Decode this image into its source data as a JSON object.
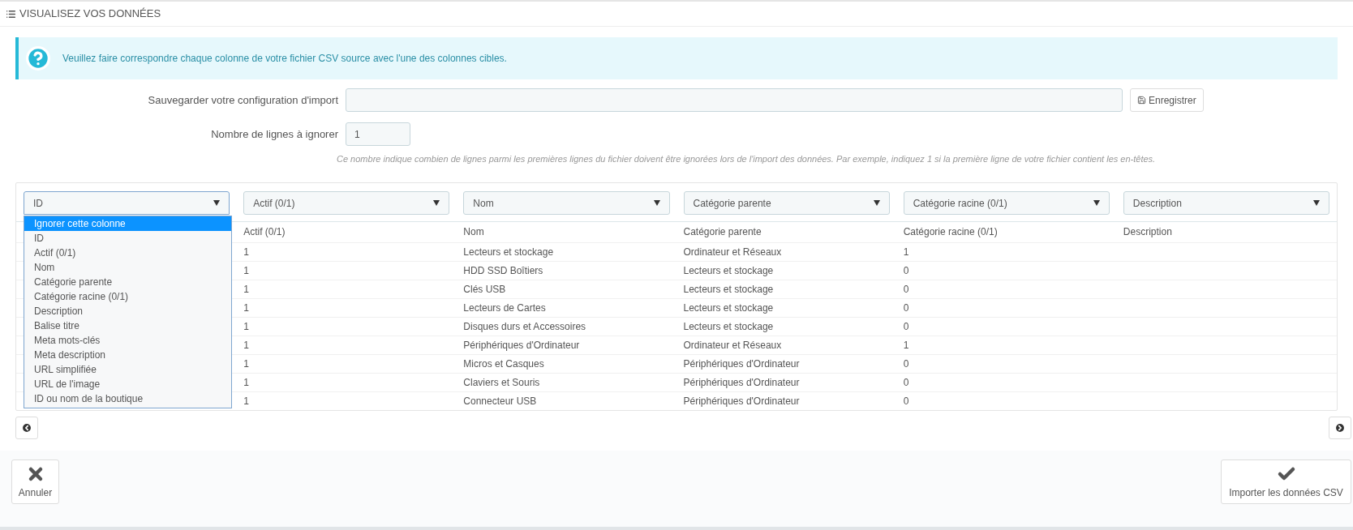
{
  "panel_title": "VISUALISEZ VOS DONNÉES",
  "alert": "Veuillez faire correspondre chaque colonne de votre fichier CSV source avec l'une des colonnes cibles.",
  "save_config": {
    "label": "Sauvegarder votre configuration d'import",
    "button": "Enregistrer"
  },
  "skip_lines": {
    "label": "Nombre de lignes à ignorer",
    "value": "1",
    "help": "Ce nombre indique combien de lignes parmi les premières lignes du fichier doivent être ignorées lors de l'import des données. Par exemple, indiquez 1 si la première ligne de votre fichier contient les en-têtes."
  },
  "column_selects": [
    {
      "value": "ID",
      "expanded": true,
      "options": [
        {
          "label": "Ignorer cette colonne",
          "highlighted": true
        },
        {
          "label": "ID",
          "highlighted": false
        },
        {
          "label": "Actif (0/1)",
          "highlighted": false
        },
        {
          "label": "Nom",
          "highlighted": false
        },
        {
          "label": "Catégorie parente",
          "highlighted": false
        },
        {
          "label": "Catégorie racine (0/1)",
          "highlighted": false
        },
        {
          "label": "Description",
          "highlighted": false
        },
        {
          "label": "Balise titre",
          "highlighted": false
        },
        {
          "label": "Meta mots-clés",
          "highlighted": false
        },
        {
          "label": "Meta description",
          "highlighted": false
        },
        {
          "label": "URL simplifiée",
          "highlighted": false
        },
        {
          "label": "URL de l'image",
          "highlighted": false
        },
        {
          "label": "ID ou nom de la boutique",
          "highlighted": false
        }
      ]
    },
    {
      "value": "Actif (0/1)",
      "expanded": false
    },
    {
      "value": "Nom",
      "expanded": false
    },
    {
      "value": "Catégorie parente",
      "expanded": false
    },
    {
      "value": "Catégorie racine (0/1)",
      "expanded": false
    },
    {
      "value": "Description",
      "expanded": false
    }
  ],
  "table": {
    "columns": [
      "Actif (0/1)",
      "Nom",
      "Catégorie parente",
      "Catégorie racine (0/1)",
      "Description"
    ],
    "rows": [
      [
        "1",
        "Lecteurs et stockage",
        "Ordinateur et Réseaux",
        "1",
        ""
      ],
      [
        "1",
        "HDD SSD Boîtiers",
        "Lecteurs et stockage",
        "0",
        ""
      ],
      [
        "1",
        "Clés USB",
        "Lecteurs et stockage",
        "0",
        ""
      ],
      [
        "1",
        "Lecteurs de Cartes",
        "Lecteurs et stockage",
        "0",
        ""
      ],
      [
        "1",
        "Disques durs et Accessoires",
        "Lecteurs et stockage",
        "0",
        ""
      ],
      [
        "1",
        "Périphériques d'Ordinateur",
        "Ordinateur et Réseaux",
        "1",
        ""
      ],
      [
        "1",
        "Micros et Casques",
        "Périphériques d'Ordinateur",
        "0",
        ""
      ],
      [
        "1",
        "Claviers et Souris",
        "Périphériques d'Ordinateur",
        "0",
        ""
      ],
      [
        "1",
        "Connecteur USB",
        "Périphériques d'Ordinateur",
        "0",
        ""
      ]
    ]
  },
  "footer": {
    "cancel": "Annuler",
    "submit": "Importer les données CSV"
  }
}
